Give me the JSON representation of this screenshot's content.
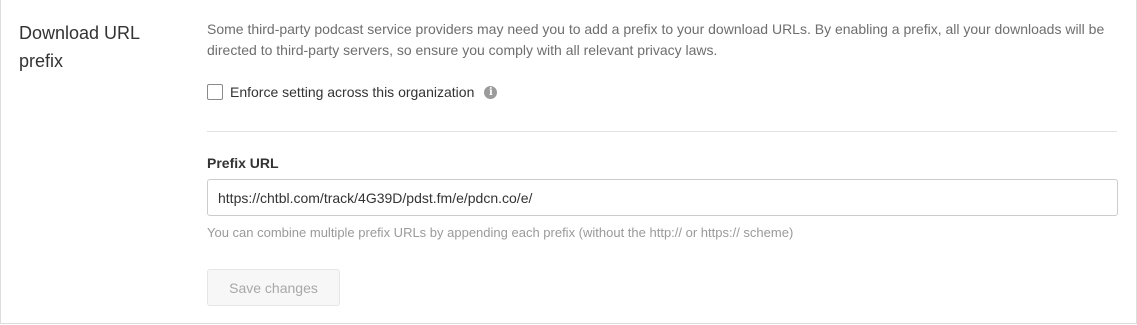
{
  "section": {
    "title": "Download URL prefix",
    "description": "Some third-party podcast service providers may need you to add a prefix to your download URLs. By enabling a prefix, all your downloads will be directed to third-party servers, so ensure you comply with all relevant privacy laws."
  },
  "enforce": {
    "label": "Enforce setting across this organization",
    "checked": false,
    "info_icon": "info-icon",
    "info_glyph": "i"
  },
  "prefix_field": {
    "label": "Prefix URL",
    "value": "https://chtbl.com/track/4G39D/pdst.fm/e/pdcn.co/e/",
    "help": "You can combine multiple prefix URLs by appending each prefix (without the http:// or https:// scheme)"
  },
  "actions": {
    "save_label": "Save changes",
    "save_enabled": false
  },
  "colors": {
    "text": "#333333",
    "muted_text": "#6e6e6e",
    "hint_text": "#9a9a9a",
    "border": "#cccccc",
    "disabled_button_bg": "#f7f7f7"
  }
}
